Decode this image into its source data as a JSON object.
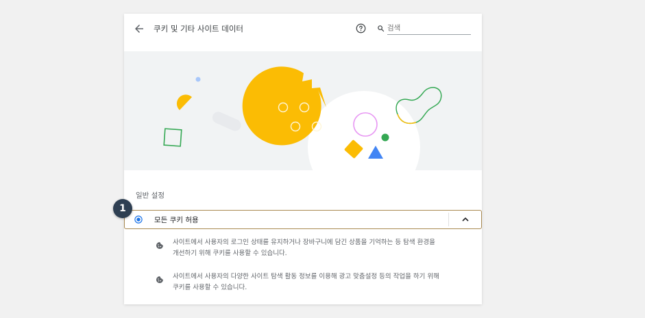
{
  "header": {
    "title": "쿠키 및 기타 사이트 데이터",
    "search_placeholder": "검색",
    "icons": {
      "back": "arrow-back-icon",
      "help": "help-circle-icon",
      "search": "search-icon"
    }
  },
  "section": {
    "label": "일반 설정"
  },
  "option": {
    "label": "모든 쿠키 허용",
    "selected": true
  },
  "descriptions": [
    {
      "line1": "사이트에서 사용자의 로그인 상태를 유지하거나 장바구니에 담긴 상품을 기억하는 등 탐색 환경을",
      "line2": "개선하기 위해 쿠키를 사용할 수 있습니다.",
      "icon": "cookie-icon"
    },
    {
      "line1": "사이트에서 사용자의 다양한 사이트 탐색 활동 정보를 이용해 광고 맞춤설정 등의 작업을 하기 위해",
      "line2": "쿠키를 사용할 수 있습니다.",
      "icon": "cookie-icon"
    }
  ],
  "callout": {
    "number": "1"
  },
  "colors": {
    "accent": "#1a73e8",
    "cookie": "#fbbc04",
    "callout_bg": "#2e3f52",
    "highlight_border": "#a8884f"
  }
}
